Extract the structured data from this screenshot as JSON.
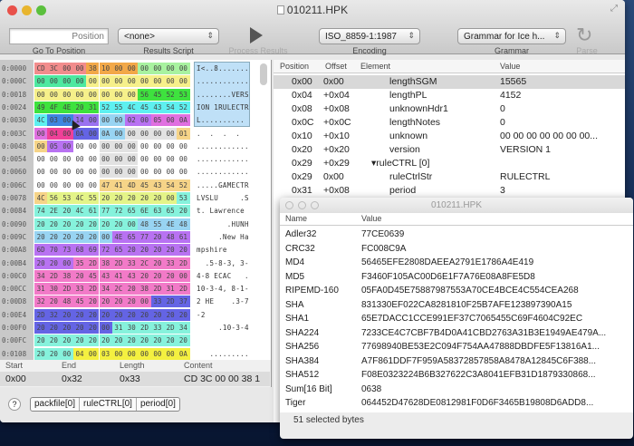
{
  "window": {
    "title": "010211.HPK"
  },
  "toolbar": {
    "position_placeholder": "Position",
    "goto_label": "Go To Position",
    "results_script_value": "<none>",
    "results_script_label": "Results Script",
    "process_label": "Process Results",
    "encoding_value": "ISO_8859-1:1987",
    "encoding_label": "Encoding",
    "grammar_value": "Grammar for Ice h...",
    "grammar_label": "Grammar",
    "parse_label": "Parse"
  },
  "colors": {
    "r": "#f28c8c",
    "o": "#f2a848",
    "g": "#a8f2a0",
    "t": "#4ee8a0",
    "y": "#f6f08a",
    "G": "#3ee23e",
    "c": "#5ef0f0",
    "b": "#3e86e0",
    "p": "#9a72f0",
    "l": "#98d4f2",
    "v": "#b872f2",
    "m": "#e070e0",
    "M": "#f04098",
    "B": "#6464e4",
    "w": "#ffffff",
    "s": "#e2e2e2",
    "Y": "#f6d488",
    "L": "#e4f488",
    "a": "#86f2dc",
    "P": "#f27ac8",
    "Q": "#f4f040"
  },
  "hex": {
    "rows": [
      {
        "addr": "0:0000",
        "bytes": "CD 3C 00 00 38 10 00 00 00 00 00 00",
        "colors": "rrrroooogggg",
        "ascii": "I<..8......."
      },
      {
        "addr": "0:000C",
        "bytes": "00 00 00 00 00 00 00 00 00 00 00 00",
        "colors": "ttttyyyyyyyy",
        "ascii": "............"
      },
      {
        "addr": "0:0018",
        "bytes": "00 00 00 00 00 00 00 00 56 45 52 53",
        "colors": "yyyyyyyyGGGG",
        "ascii": "........VERS"
      },
      {
        "addr": "0:0024",
        "bytes": "49 4F 4E 20 31 52 55 4C 45 43 54 52",
        "colors": "GGGGGccccccc",
        "ascii": "ION 1RULECTR"
      },
      {
        "addr": "0:0030",
        "bytes": "4C 03 00 14 00 00 00 02 00 05 00 0A",
        "colors": "cbbppllvvmmm",
        "ascii": "L.........."
      },
      {
        "addr": "0:003C",
        "bytes": "00 04 00 0A 00 0A 00 00 00 00 00 01",
        "colors": "mMMBBllssssY",
        "ascii": ".  .  .  ."
      },
      {
        "addr": "0:0048",
        "bytes": "00 05 00 00 00 00 00 00 00 00 00 00",
        "colors": "YvvwwssswWww",
        "ascii": "............"
      },
      {
        "addr": "0:0054",
        "bytes": "00 00 00 00 00 00 00 00 00 00 00 00",
        "colors": "wwwwwssswwww",
        "ascii": "............"
      },
      {
        "addr": "0:0060",
        "bytes": "00 00 00 00 00 00 00 00 00 00 00 00",
        "colors": "wwwwwssswwww",
        "ascii": "............"
      },
      {
        "addr": "0:006C",
        "bytes": "00 00 00 00 00 47 41 4D 45 43 54 52",
        "colors": "wwwwwYYYYYYY",
        "ascii": ".....GAMECTR"
      },
      {
        "addr": "0:0078",
        "bytes": "4C 56 53 4C 55 20 20 20 20 20 00 53",
        "colors": "YLLLLLLLLLLa",
        "ascii": "LVSLU     .S"
      },
      {
        "addr": "0:0084",
        "bytes": "74 2E 20 4C 61 77 72 65 6E 63 65 20",
        "colors": "aaaaaaaaaaaa",
        "ascii": "t. Lawrence"
      },
      {
        "addr": "0:0090",
        "bytes": "20 20 20 20 20 20 20 00 48 55 4E 48",
        "colors": "aaaaaaaallll",
        "ascii": "       .HUNH"
      },
      {
        "addr": "0:009C",
        "bytes": "20 20 20 20 20 00 4E 65 77 20 48 61",
        "colors": "llllllvvvvvv",
        "ascii": "     .New Ha"
      },
      {
        "addr": "0:00A8",
        "bytes": "6D 70 73 68 69 72 65 20 20 20 20 20",
        "colors": "vvvvvvvvvvvv",
        "ascii": "mpshire"
      },
      {
        "addr": "0:00B4",
        "bytes": "20 20 00 35 2D 38 2D 33 2C 20 33 2D",
        "colors": "vvvPPPPPPPPP",
        "ascii": "  .5-8-3, 3-"
      },
      {
        "addr": "0:00C0",
        "bytes": "34 2D 38 20 45 43 41 43 20 20 20 00",
        "colors": "PPPPPPPPPPPP",
        "ascii": "4-8 ECAC   ."
      },
      {
        "addr": "0:00CC",
        "bytes": "31 30 2D 33 2D 34 2C 20 38 2D 31 2D",
        "colors": "PPPPPPPPPPPP",
        "ascii": "10-3-4, 8-1-"
      },
      {
        "addr": "0:00D8",
        "bytes": "32 20 48 45 20 20 20 20 00 33 2D 37",
        "colors": "PPPPPPPPPBBB",
        "ascii": "2 HE    .3-7"
      },
      {
        "addr": "0:00E4",
        "bytes": "2D 32 20 20 20 20 20 20 20 20 20 20",
        "colors": "BBBBBBBBBBBB",
        "ascii": "-2"
      },
      {
        "addr": "0:00F0",
        "bytes": "20 20 20 20 20 00 31 30 2D 33 2D 34",
        "colors": "BBBBBBaaaaaa",
        "ascii": "     .10-3-4"
      },
      {
        "addr": "0:00FC",
        "bytes": "20 20 20 20 20 20 20 20 20 20 20 20",
        "colors": "aaaaaaaaaaaa",
        "ascii": ""
      },
      {
        "addr": "0:0108",
        "bytes": "20 20 00 04 00 03 00 00 00 00 00 0A",
        "colors": "aaaQQQQQQQQQ",
        "ascii": "   ........."
      }
    ]
  },
  "range": {
    "headers": [
      "Start",
      "End",
      "Length",
      "Content"
    ],
    "values": [
      "0x00",
      "0x32",
      "0x33",
      "CD 3C 00 00 38 1"
    ]
  },
  "breadcrumb": [
    "packfile[0]",
    "ruleCTRL[0]",
    "period[0]"
  ],
  "results": {
    "headers": [
      "Position",
      "Offset",
      "Element",
      "Value"
    ],
    "rows": [
      {
        "position": "0x00",
        "offset": "0x00",
        "element": "lengthSGM",
        "value": "15565",
        "selected": true
      },
      {
        "position": "0x04",
        "offset": "+0x04",
        "element": "lengthPL",
        "value": "4152"
      },
      {
        "position": "0x08",
        "offset": "+0x08",
        "element": "unknownHdr1",
        "value": "0"
      },
      {
        "position": "0x0C",
        "offset": "+0x0C",
        "element": "lengthNotes",
        "value": "0"
      },
      {
        "position": "0x10",
        "offset": "+0x10",
        "element": "unknown",
        "value": "00 00 00 00 00 00 00..."
      },
      {
        "position": "0x20",
        "offset": "+0x20",
        "element": "version",
        "value": "VERSION 1"
      },
      {
        "position": "0x29",
        "offset": "+0x29",
        "element": "▾ruleCTRL [0]",
        "value": "",
        "group": true
      },
      {
        "position": "0x29",
        "offset": "0x00",
        "element": "ruleCtrlStr",
        "value": "RULECTRL"
      },
      {
        "position": "0x31",
        "offset": "+0x08",
        "element": "period",
        "value": "3"
      }
    ]
  },
  "hashes": {
    "title": "010211.HPK",
    "headers": [
      "Name",
      "Value"
    ],
    "rows": [
      {
        "name": "Adler32",
        "value": "77CE0639"
      },
      {
        "name": "CRC32",
        "value": "FC008C9A"
      },
      {
        "name": "MD4",
        "value": "56465EFE2808DAEEA2791E1786A4E419"
      },
      {
        "name": "MD5",
        "value": "F3460F105AC00D6E1F7A76E08A8FE5D8"
      },
      {
        "name": "RIPEMD-160",
        "value": "05FA0D45E75887987553A70CE4BCE4C554CEA268"
      },
      {
        "name": "SHA",
        "value": "831330EF022CA8281810F25B7AFE123897390A15"
      },
      {
        "name": "SHA1",
        "value": "65E7DACC1CCE991EF37C7065455C69F4604C92EC"
      },
      {
        "name": "SHA224",
        "value": "7233CE4C7CBF7B4D0A41CBD2763A31B3E1949AE479A..."
      },
      {
        "name": "SHA256",
        "value": "77698940BE53E2C094F754AA47888DBDFE5F13816A1..."
      },
      {
        "name": "SHA384",
        "value": "A7F861DDF7F959A58372857858A8478A12845C6F388..."
      },
      {
        "name": "SHA512",
        "value": "F08E0323224B6B327622C3A8041EFB31D1879330868..."
      },
      {
        "name": "Sum[16 Bit]",
        "value": "0638"
      },
      {
        "name": "Tiger",
        "value": "064452D47628DE0812981F0D6F3465B19808D6ADD8..."
      }
    ],
    "status": "51 selected bytes"
  }
}
